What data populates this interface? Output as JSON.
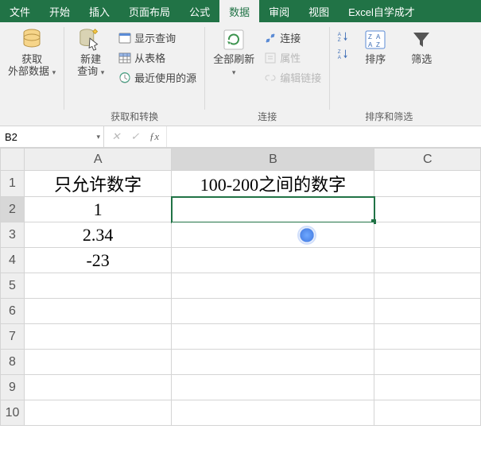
{
  "tabs": {
    "file": "文件",
    "home": "开始",
    "insert": "插入",
    "layout": "页面布局",
    "formulas": "公式",
    "data": "数据",
    "review": "审阅",
    "view": "视图",
    "custom": "Excel自学成才"
  },
  "ribbon": {
    "get_data": {
      "label_line1": "获取",
      "label_line2": "外部数据"
    },
    "new_query": {
      "label_line1": "新建",
      "label_line2": "查询"
    },
    "show_queries": "显示查询",
    "from_table": "从表格",
    "recent_sources": "最近使用的源",
    "group_transform": "获取和转换",
    "refresh_all": "全部刷新",
    "connections": "连接",
    "properties": "属性",
    "edit_links": "编辑链接",
    "group_connections": "连接",
    "sort": "排序",
    "filter": "筛选",
    "group_sort_filter": "排序和筛选"
  },
  "namebox": {
    "value": "B2"
  },
  "formula": {
    "value": ""
  },
  "columns": {
    "A": "A",
    "B": "B",
    "C": "C"
  },
  "rows": [
    "1",
    "2",
    "3",
    "4",
    "5",
    "6",
    "7",
    "8",
    "9",
    "10"
  ],
  "cells": {
    "A1": "只允许数字",
    "B1": "100-200之间的数字",
    "A2": "1",
    "A3": "2.34",
    "A4": "-23"
  },
  "chart_data": {
    "type": "table",
    "title": "",
    "columns": [
      "A",
      "B"
    ],
    "headers": [
      "只允许数字",
      "100-200之间的数字"
    ],
    "rows": [
      {
        "A": 1,
        "B": null
      },
      {
        "A": 2.34,
        "B": null
      },
      {
        "A": -23,
        "B": null
      }
    ]
  }
}
